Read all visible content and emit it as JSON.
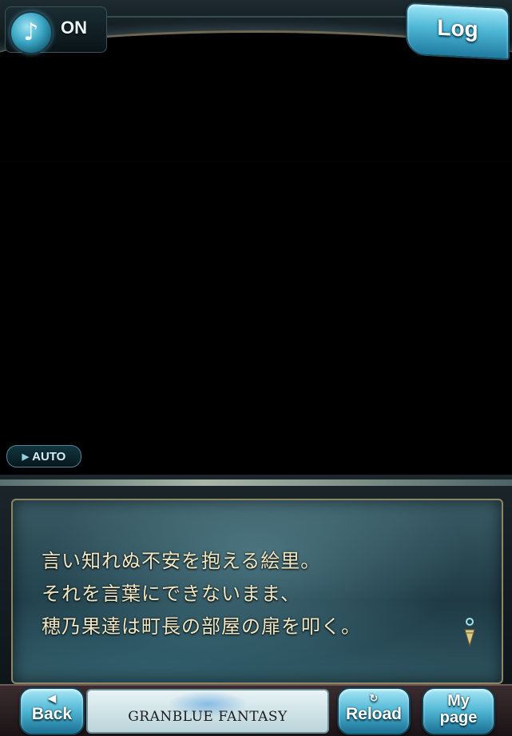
{
  "header": {
    "sound_icon": "music-note-icon",
    "sound_state": "ON",
    "log_label": "Log"
  },
  "controls": {
    "auto_label": "AUTO",
    "auto_icon": "play-icon"
  },
  "dialog": {
    "lines": [
      "言い知れぬ不安を抱える絵里。",
      "それを言葉にできないまま、",
      "穂乃果達は町長の部屋の扉を叩く。"
    ],
    "next_icon": "next-page-indicator-icon"
  },
  "footer": {
    "back_label": "Back",
    "back_icon": "left-arrow-icon",
    "logo_text": "GRANBLUE FANTASY",
    "reload_label": "Reload",
    "reload_icon": "reload-icon",
    "mypage_line1": "My",
    "mypage_line2": "page"
  },
  "colors": {
    "accent_blue": "#4fb8d6",
    "dialog_text": "#efe7c3",
    "frame_gold": "#8c8664"
  }
}
